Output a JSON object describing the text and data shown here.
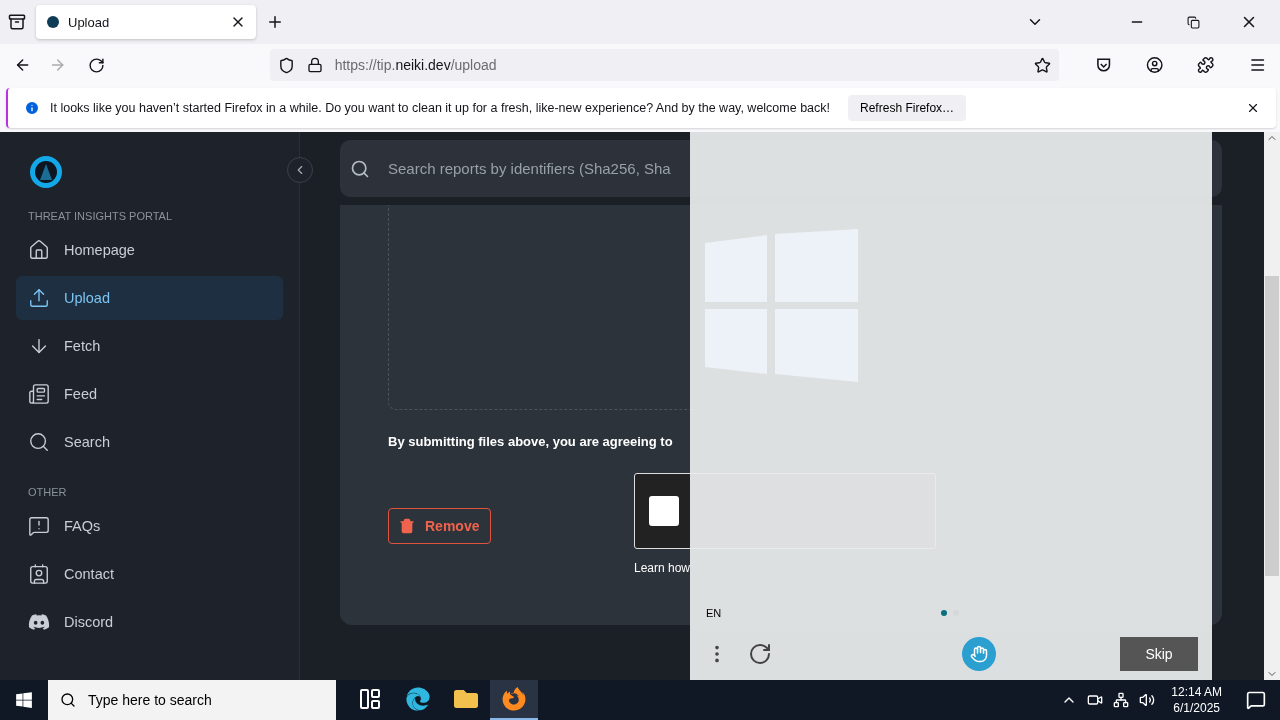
{
  "browser": {
    "tabs": [
      {
        "title": "Upload",
        "selected": true
      }
    ],
    "url": {
      "prefix": "https://tip.",
      "domain": "neiki.dev",
      "suffix": "/upload"
    },
    "notification": {
      "message": "It looks like you haven’t started Firefox in a while. Do you want to clean it up for a fresh, like-new experience? And by the way, welcome back!",
      "button": "Refresh Firefox…"
    }
  },
  "sidebar": {
    "sections": [
      {
        "title": "THREAT INSIGHTS PORTAL",
        "items": [
          {
            "label": "Homepage",
            "selected": false
          },
          {
            "label": "Upload",
            "selected": true
          },
          {
            "label": "Fetch",
            "selected": false
          },
          {
            "label": "Feed",
            "selected": false
          },
          {
            "label": "Search",
            "selected": false
          }
        ]
      },
      {
        "title": "OTHER",
        "items": [
          {
            "label": "FAQs",
            "selected": false
          },
          {
            "label": "Contact",
            "selected": false
          },
          {
            "label": "Discord",
            "selected": false
          }
        ]
      }
    ]
  },
  "header": {
    "search": {
      "placeholder": "Search reports by identifiers (Sha256, Sha"
    }
  },
  "upload": {
    "agreement": "By submitting files above, you are agreeing to",
    "remove": "Remove",
    "captcha": {
      "checked": false
    },
    "help": "Learn how"
  },
  "challenge": {
    "language": "EN",
    "pages": [
      {
        "selected": true
      },
      {
        "selected": false
      }
    ],
    "skip": "Skip"
  },
  "taskbar": {
    "search_placeholder": "Type here to search",
    "apps": [
      {
        "selected": false
      },
      {
        "selected": false
      },
      {
        "selected": false
      },
      {
        "selected": true
      }
    ],
    "time": "12:14 AM",
    "date": "6/1/2025"
  }
}
